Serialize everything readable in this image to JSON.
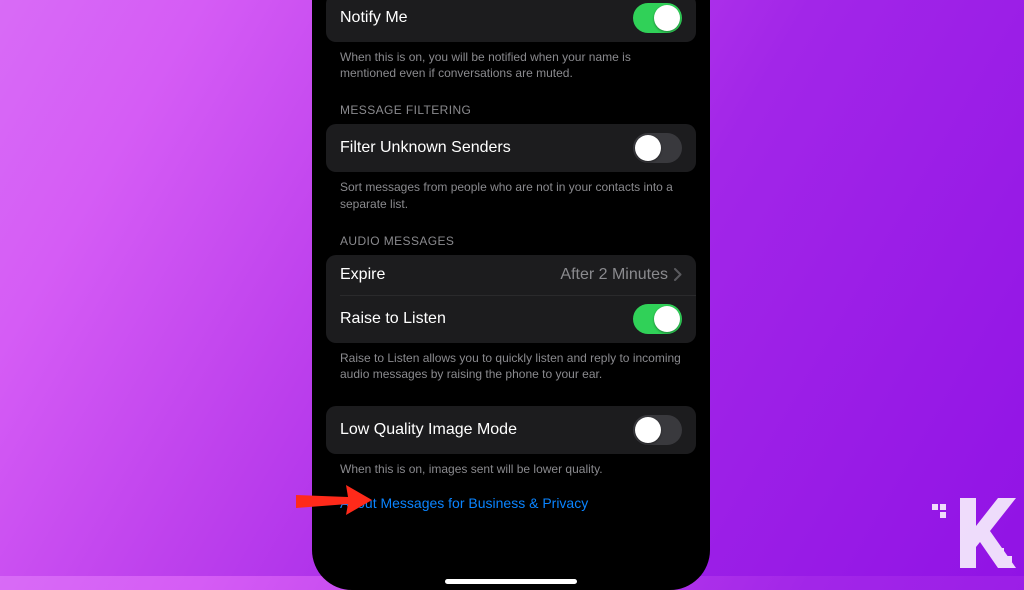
{
  "colors": {
    "accent_green": "#30d158",
    "bg_cell": "#1c1c1e",
    "link": "#0a84ff",
    "arrow": "#ff2a1a"
  },
  "sections": {
    "mentions": {
      "row_notify": {
        "label": "Notify Me",
        "state": "on"
      },
      "footer": "When this is on, you will be notified when your name is mentioned even if conversations are muted."
    },
    "filtering": {
      "header": "MESSAGE FILTERING",
      "row_filter": {
        "label": "Filter Unknown Senders",
        "state": "off"
      },
      "footer": "Sort messages from people who are not in your contacts into a separate list."
    },
    "audio": {
      "header": "AUDIO MESSAGES",
      "row_expire": {
        "label": "Expire",
        "value": "After 2 Minutes"
      },
      "row_raise": {
        "label": "Raise to Listen",
        "state": "on"
      },
      "footer": "Raise to Listen allows you to quickly listen and reply to incoming audio messages by raising the phone to your ear."
    },
    "lowq": {
      "row": {
        "label": "Low Quality Image Mode",
        "state": "off"
      },
      "footer": "When this is on, images sent will be lower quality."
    },
    "link": {
      "label": "About Messages for Business & Privacy"
    }
  }
}
